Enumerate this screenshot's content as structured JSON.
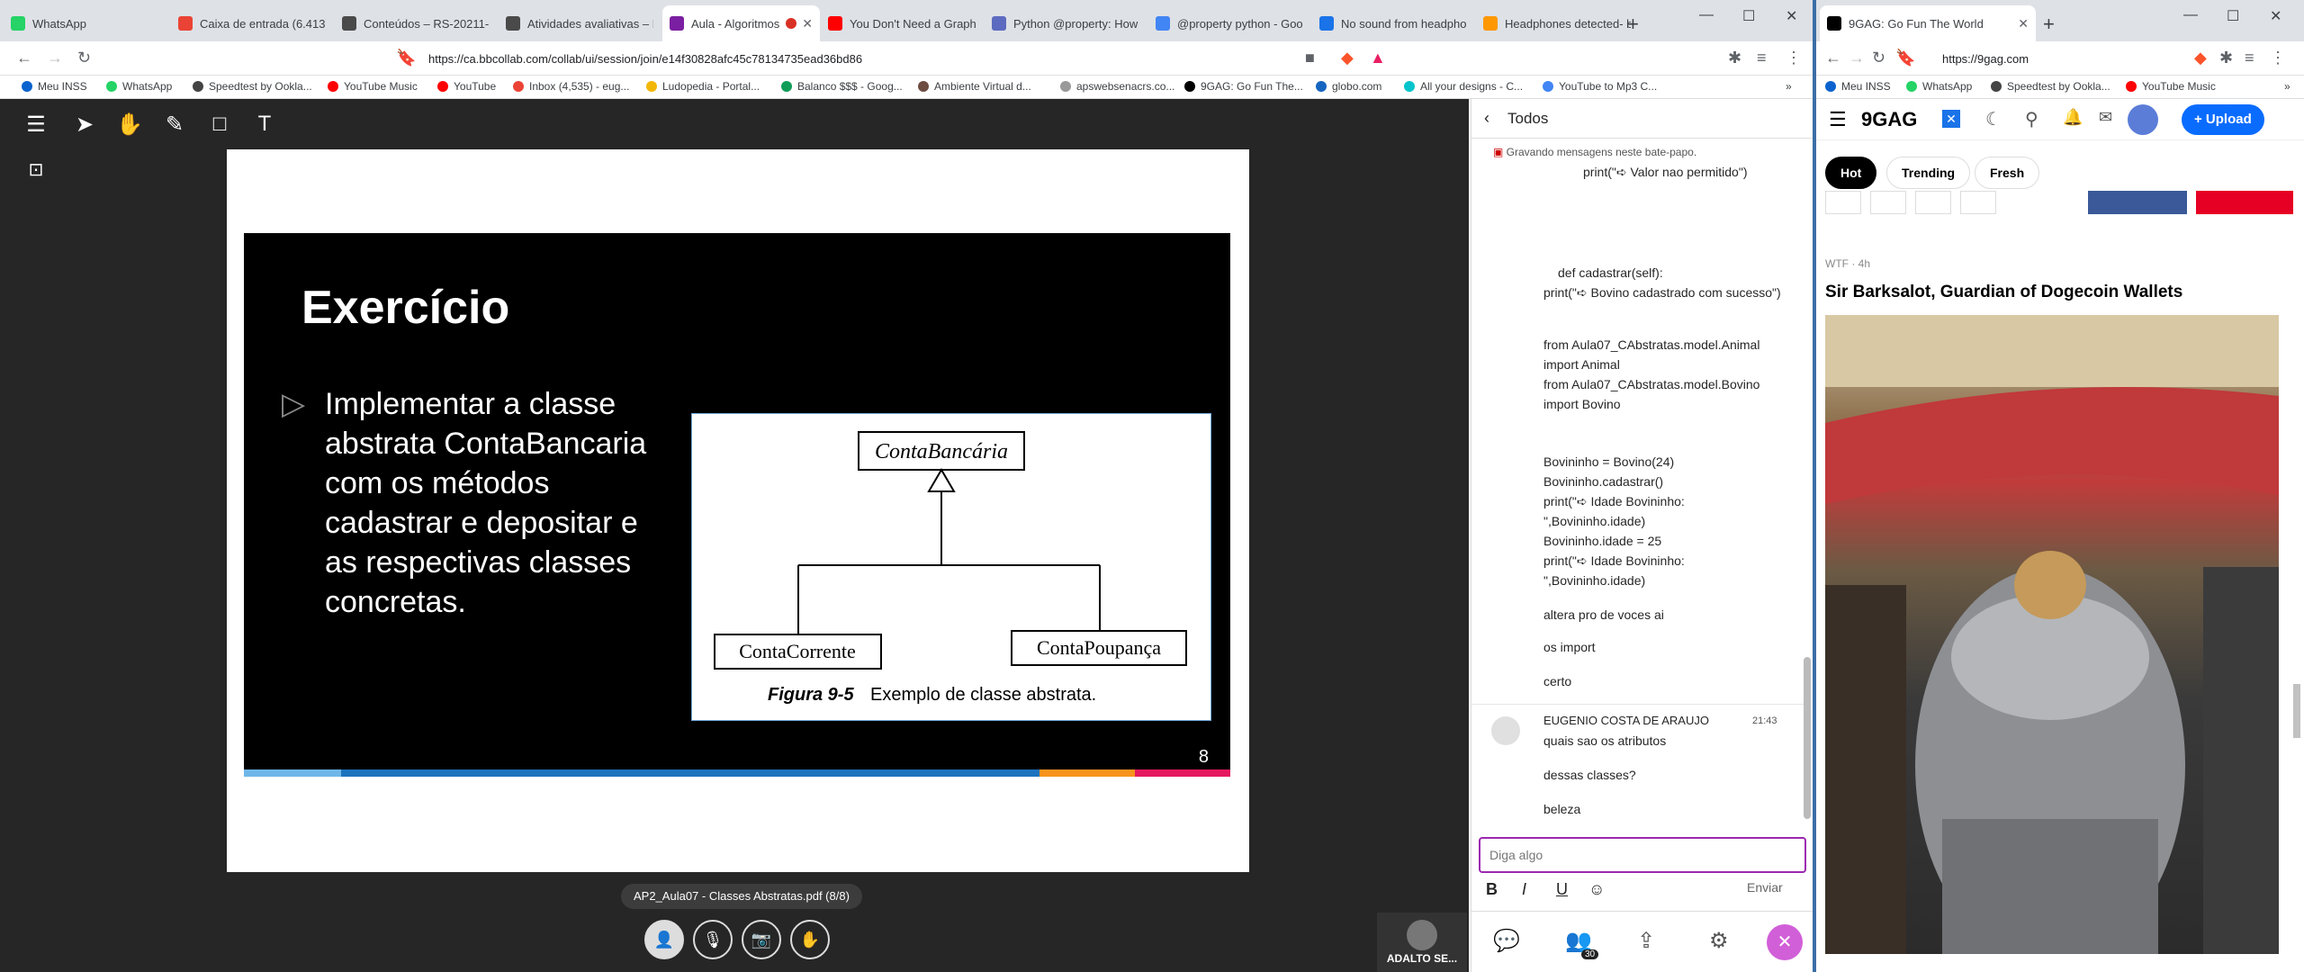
{
  "left_browser": {
    "tabs": [
      {
        "title": "WhatsApp",
        "color": "#25d366"
      },
      {
        "title": "Caixa de entrada (6.413) -",
        "color": "#ea4335"
      },
      {
        "title": "Conteúdos – RS-20211-FS",
        "color": "#4a4a4a"
      },
      {
        "title": "Atividades avaliativas – RS",
        "color": "#4a4a4a"
      },
      {
        "title": "Aula - Algoritmos",
        "color": "#7b1fa2"
      },
      {
        "title": "You Don't Need a Graphic",
        "color": "#ff0000"
      },
      {
        "title": "Python @property: How to",
        "color": "#5c6bc0"
      },
      {
        "title": "@property python - Goog",
        "color": "#4285f4"
      },
      {
        "title": "No sound from headphon",
        "color": "#1a73e8"
      },
      {
        "title": "Headphones detected- bu",
        "color": "#ff9800"
      }
    ],
    "url": "https://ca.bbcollab.com/collab/ui/session/join/e14f30828afc45c78134735ead36bd86",
    "bookmarks": [
      {
        "label": "Meu INSS",
        "color": "#0b63ce"
      },
      {
        "label": "WhatsApp",
        "color": "#25d366"
      },
      {
        "label": "Speedtest by Ookla...",
        "color": "#444444"
      },
      {
        "label": "YouTube Music",
        "color": "#ff0000"
      },
      {
        "label": "YouTube",
        "color": "#ff0000"
      },
      {
        "label": "Inbox (4,535) - eug...",
        "color": "#ea4335"
      },
      {
        "label": "Ludopedia - Portal...",
        "color": "#f2b705"
      },
      {
        "label": "Balanco $$$ - Goog...",
        "color": "#0f9d58"
      },
      {
        "label": "Ambiente Virtual d...",
        "color": "#6d4c41"
      },
      {
        "label": "apswebsenacrs.co...",
        "color": "#999999"
      },
      {
        "label": "9GAG: Go Fun The...",
        "color": "#000000"
      },
      {
        "label": "globo.com",
        "color": "#1565c0"
      },
      {
        "label": "All your designs - C...",
        "color": "#00c4cc"
      },
      {
        "label": "YouTube to Mp3 C...",
        "color": "#4285f4"
      }
    ]
  },
  "slide": {
    "title": "Exercício",
    "bullet_text": "Implementar a classe abstrata ContaBancaria com os métodos cadastrar e depositar e as respectivas classes concretas.",
    "figure": {
      "parent": "ContaBancária",
      "child_left": "ContaCorrente",
      "child_right": "ContaPoupança",
      "caption_italic": "Figura 9-5",
      "caption": "Exemplo de classe abstrata."
    },
    "page_number": "8"
  },
  "pdf_name": "AP2_Aula07 - Classes Abstratas.pdf   (8/8)",
  "presenter_name": "ADALTO SE...",
  "chat": {
    "header": "Todos",
    "recording_note": "Gravando mensagens neste bate-papo.",
    "line1": "print(\"➪ Valor nao permitido\")",
    "def_line": "def cadastrar(self):",
    "print_cadastrado": "print(\"➪ Bovino cadastrado com sucesso\")",
    "import1": "from Aula07_CAbstratas.model.Animal import Animal",
    "import2": "from Aula07_CAbstratas.model.Bovino import Bovino",
    "code1": "Bovininho = Bovino(24)",
    "code2": "Bovininho.cadastrar()",
    "code3": "print(\"➪ Idade Bovininho: \",Bovininho.idade)",
    "code4": "Bovininho.idade = 25",
    "code5": "print(\"➪ Idade Bovininho: \",Bovininho.idade)",
    "msg_altera": "altera pro de voces ai",
    "msg_import": "os import",
    "msg_certo": "certo",
    "author": "EUGENIO COSTA DE ARAUJO",
    "time": "21:43",
    "msg_a1": "quais sao os atributos",
    "msg_a2": "dessas classes?",
    "msg_a3": "beleza",
    "input_placeholder": "Diga algo",
    "send_label": "Enviar",
    "participants_count": "30"
  },
  "right_browser": {
    "tab_title": "9GAG: Go Fun The World",
    "url": "https://9gag.com",
    "bookmarks": [
      "Meu INSS",
      "WhatsApp",
      "Speedtest by Ookla...",
      "YouTube Music"
    ],
    "logo": "9GAG",
    "upload_label": "+ Upload",
    "tabs": [
      "Hot",
      "Trending",
      "Fresh"
    ],
    "post_meta": "WTF · 4h",
    "post_title": "Sir Barksalot, Guardian of Dogecoin Wallets"
  }
}
